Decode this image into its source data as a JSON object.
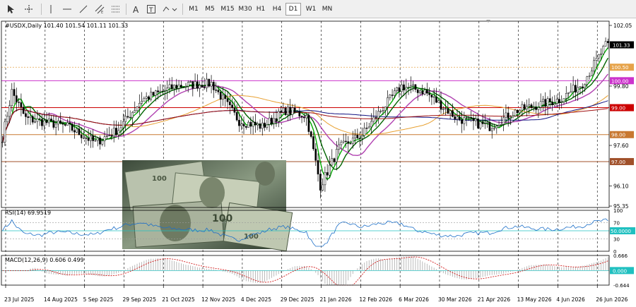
{
  "toolbar": {
    "tools": [
      "cursor-icon",
      "crosshair-icon",
      "vertical-line-icon",
      "horizontal-line-icon",
      "trendline-icon",
      "channel-icon",
      "text-icon",
      "label-icon",
      "shapes-icon"
    ],
    "timeframes": [
      "M1",
      "M5",
      "M15",
      "M30",
      "H1",
      "H4",
      "D1",
      "W1",
      "MN"
    ],
    "active_timeframe": "D1"
  },
  "chart_data": {
    "type": "candlestick",
    "header": "#USDX,Daily  101.40 101.54 101.11 101.33",
    "price_axis_ticks": [
      "102.05",
      "99.80",
      "97.60",
      "96.10",
      "95.35"
    ],
    "price_ylim": [
      95.35,
      102.05
    ],
    "current_price_tag": "101.33",
    "level_tags": [
      {
        "label": "100.50",
        "price": 100.5,
        "color": "#e6a34a",
        "style": "dotted"
      },
      {
        "label": "100.00",
        "price": 100.0,
        "color": "#cc33cc",
        "style": "solid"
      },
      {
        "label": "99.00",
        "price": 99.0,
        "color": "#cc0000",
        "style": "solid"
      },
      {
        "label": "98.00",
        "price": 98.0,
        "color": "#c87830",
        "style": "solid"
      },
      {
        "label": "97.00",
        "price": 97.0,
        "color": "#a0502a",
        "style": "solid"
      }
    ],
    "x_labels": [
      "23 Jul 2025",
      "14 Aug 2025",
      "5 Sep 2025",
      "29 Sep 2025",
      "21 Oct 2025",
      "12 Nov 2025",
      "4 Dec 2025",
      "29 Dec 2025",
      "21 Jan 2026",
      "12 Feb 2026",
      "6 Mar 2026",
      "30 Mar 2026",
      "21 Apr 2026",
      "13 May 2026",
      "4 Jun 2026",
      "26 Jun 2026"
    ],
    "close_keypoints": [
      [
        0,
        97.9
      ],
      [
        4,
        99.6
      ],
      [
        10,
        98.6
      ],
      [
        28,
        98.3
      ],
      [
        40,
        97.7
      ],
      [
        50,
        98.2
      ],
      [
        60,
        99.3
      ],
      [
        75,
        99.8
      ],
      [
        90,
        99.9
      ],
      [
        102,
        98.5
      ],
      [
        112,
        98.3
      ],
      [
        122,
        98.9
      ],
      [
        131,
        98.7
      ],
      [
        137,
        96.1
      ],
      [
        145,
        97.5
      ],
      [
        155,
        98.0
      ],
      [
        163,
        98.9
      ],
      [
        172,
        99.8
      ],
      [
        182,
        99.6
      ],
      [
        196,
        98.6
      ],
      [
        210,
        98.3
      ],
      [
        222,
        98.9
      ],
      [
        240,
        99.3
      ],
      [
        250,
        99.9
      ],
      [
        260,
        101.3
      ]
    ],
    "ma_colors": [
      "#00aa00",
      "#006400",
      "#b040b0",
      "#e8a030",
      "#101080",
      "#a01010"
    ],
    "rsi": {
      "label": "RSI(14) 69.9519",
      "value": 69.9519,
      "levels": [
        100,
        70,
        50,
        30,
        0
      ],
      "tag": "50.0000"
    },
    "macd": {
      "label": "MACD(12,26,9) 0.606 0.499",
      "macd": 0.606,
      "signal": 0.499,
      "ticks": [
        "0.666",
        "0.000",
        "-0.644"
      ],
      "tag": "0.000"
    }
  }
}
